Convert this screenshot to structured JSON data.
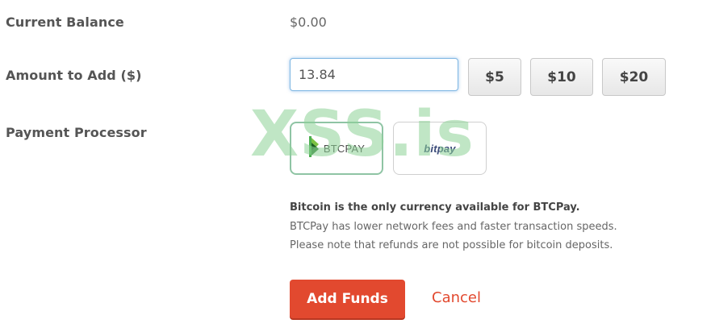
{
  "current_balance": {
    "label": "Current Balance",
    "value": "$0.00"
  },
  "amount": {
    "label": "Amount to Add ($)",
    "input_value": "13.84",
    "presets": [
      "$5",
      "$10",
      "$20"
    ]
  },
  "payment_processor": {
    "label": "Payment Processor",
    "options": [
      {
        "name": "BTCPAY",
        "selected": true,
        "icon": "btcpay-logo-icon"
      },
      {
        "name": "bitpay",
        "selected": false,
        "icon": "bitpay-logo-icon"
      }
    ]
  },
  "watermark": "XSS.is",
  "info": {
    "line1": "Bitcoin is the only currency available for BTCPay.",
    "line2": "BTCPay has lower network fees and faster transaction speeds.",
    "line3": "Please note that refunds are not possible for bitcoin deposits."
  },
  "actions": {
    "add_funds": "Add Funds",
    "cancel": "Cancel"
  },
  "colors": {
    "primary_button": "#e2492f",
    "selected_border": "#8fc4a4",
    "input_focus": "#7fb7e3"
  }
}
